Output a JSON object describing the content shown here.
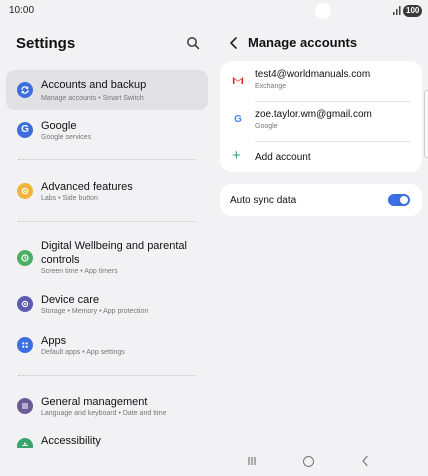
{
  "status_bar": {
    "time": "10:00",
    "battery": "100",
    "icons": [
      "camera-cutout",
      "signal-icon",
      "battery-icon"
    ]
  },
  "left_pane": {
    "title": "Settings",
    "search_icon": "search-icon",
    "items": [
      {
        "title": "Accounts and backup",
        "subtitle": "Manage accounts  •  Smart Switch",
        "icon": "sync-icon",
        "color": "#3b6fe0",
        "selected": true
      },
      {
        "title": "Google",
        "subtitle": "Google services",
        "icon": "google-g-icon",
        "color": "#3b6fe0"
      },
      {
        "title": "Advanced features",
        "subtitle": "Labs  •  Side button",
        "icon": "gear-plus-icon",
        "color": "#f2b53c"
      },
      {
        "title": "Digital Wellbeing and parental controls",
        "title_line1": "Digital Wellbeing and parental",
        "title_line2": "controls",
        "subtitle": "Screen time  •  App timers",
        "icon": "wellbeing-icon",
        "color": "#4caf64"
      },
      {
        "title": "Device care",
        "subtitle": "Storage  •  Memory  •  App protection",
        "icon": "device-care-icon",
        "color": "#5b5bb0"
      },
      {
        "title": "Apps",
        "subtitle": "Default apps  •  App settings",
        "icon": "apps-grid-icon",
        "color": "#3b6fe0"
      },
      {
        "title": "General management",
        "subtitle": "Language and keyboard  •  Date and time",
        "icon": "sliders-icon",
        "color": "#6b5b95"
      },
      {
        "title": "Accessibility",
        "icon": "accessibility-icon",
        "color": "#3aa36c"
      }
    ]
  },
  "right_pane": {
    "title": "Manage accounts",
    "back_icon": "back-chevron-icon",
    "accounts": [
      {
        "email": "test4@worldmanuals.com",
        "type": "Exchange",
        "icon": "gmail-icon"
      },
      {
        "email": "zoe.taylor.wm@gmail.com",
        "type": "Google",
        "icon": "google-g-icon"
      }
    ],
    "add_account": "Add account",
    "auto_sync": {
      "label": "Auto sync data",
      "enabled": true
    }
  },
  "nav_bar": {
    "icons": [
      "recents-icon",
      "home-icon",
      "back-icon"
    ]
  },
  "colors": {
    "background": "#f2f2f4",
    "accent": "#3b6fe0",
    "selected_row": "#e1e1e4",
    "add_green": "#3aa36c"
  }
}
